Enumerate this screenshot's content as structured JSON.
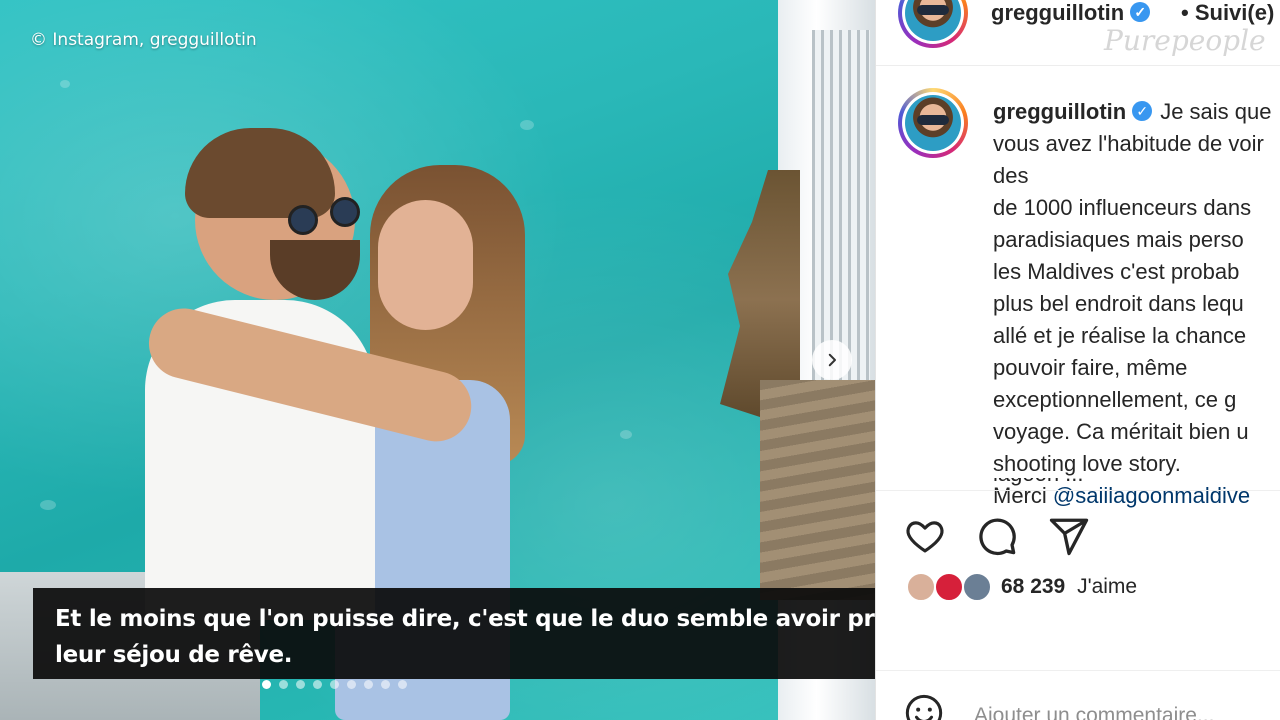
{
  "photo": {
    "credit": "© Instagram, gregguillotin",
    "slide_count": 9,
    "active_slide": 1
  },
  "caption_overlay": {
    "text": "Et le moins que l'on puisse dire, c'est que le duo semble avoir profité de chaque instant de leur séjou de rêve."
  },
  "header": {
    "username": "gregguillotin",
    "separator": "•",
    "follow_status": "Suivi(e)",
    "watermark": "Purepeople"
  },
  "post": {
    "username": "gregguillotin",
    "text": "Je sais que vous avez l'habitude de voir des\nde 1000 influenceurs dans\nparadisiaques mais perso\nles Maldives c'est probab\nplus bel endroit dans lequ\nallé et je réalise la chance\npouvoir faire, même\nexceptionnellement, ce g\nvoyage. Ca méritait bien u\nshooting love story.",
    "thanks_prefix": "Merci ",
    "mention": "@saiilagoonmaldive",
    "cut_line": "lagoon ..."
  },
  "actions": {
    "like_icon": "heart-icon",
    "comment_icon": "comment-icon",
    "share_icon": "share-icon"
  },
  "likes": {
    "count": "68 239",
    "label": "J'aime"
  },
  "comment": {
    "placeholder": "Ajouter un commentaire..."
  },
  "colors": {
    "accent_blue": "#3897f0",
    "mention": "#00376b",
    "text": "#262626",
    "muted": "#8e8e8e"
  }
}
